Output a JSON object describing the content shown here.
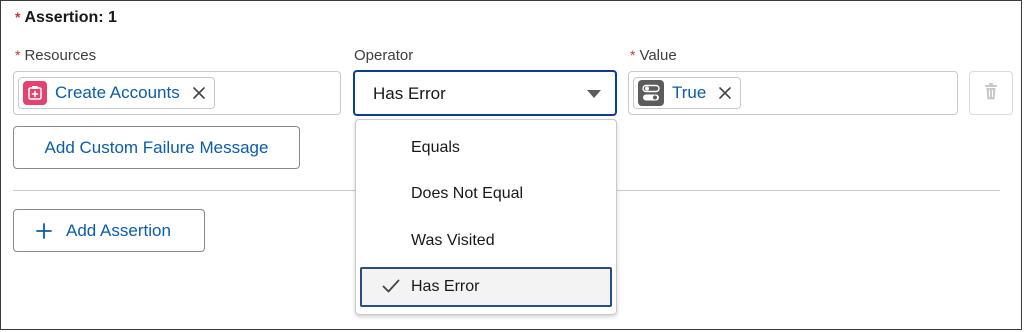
{
  "assertion": {
    "title": "Assertion: 1",
    "required_marker": "*"
  },
  "resources": {
    "label": "Resources",
    "pill_label": "Create Accounts",
    "pill_icon": "resource-icon",
    "remove_icon": "close-icon"
  },
  "operator": {
    "label": "Operator",
    "selected": "Has Error",
    "options": [
      "Equals",
      "Does Not Equal",
      "Was Visited",
      "Has Error"
    ],
    "selected_index": 3
  },
  "value": {
    "label": "Value",
    "pill_label": "True",
    "pill_icon": "toggle-icon",
    "remove_icon": "close-icon"
  },
  "actions": {
    "add_custom_failure": "Add Custom Failure Message",
    "add_assertion": "Add Assertion",
    "delete_icon": "trash-icon"
  },
  "colors": {
    "link": "#0b5cab",
    "required": "#c23934",
    "focus_border": "#0b3d91",
    "resource_icon_bg": "#e3436e"
  }
}
